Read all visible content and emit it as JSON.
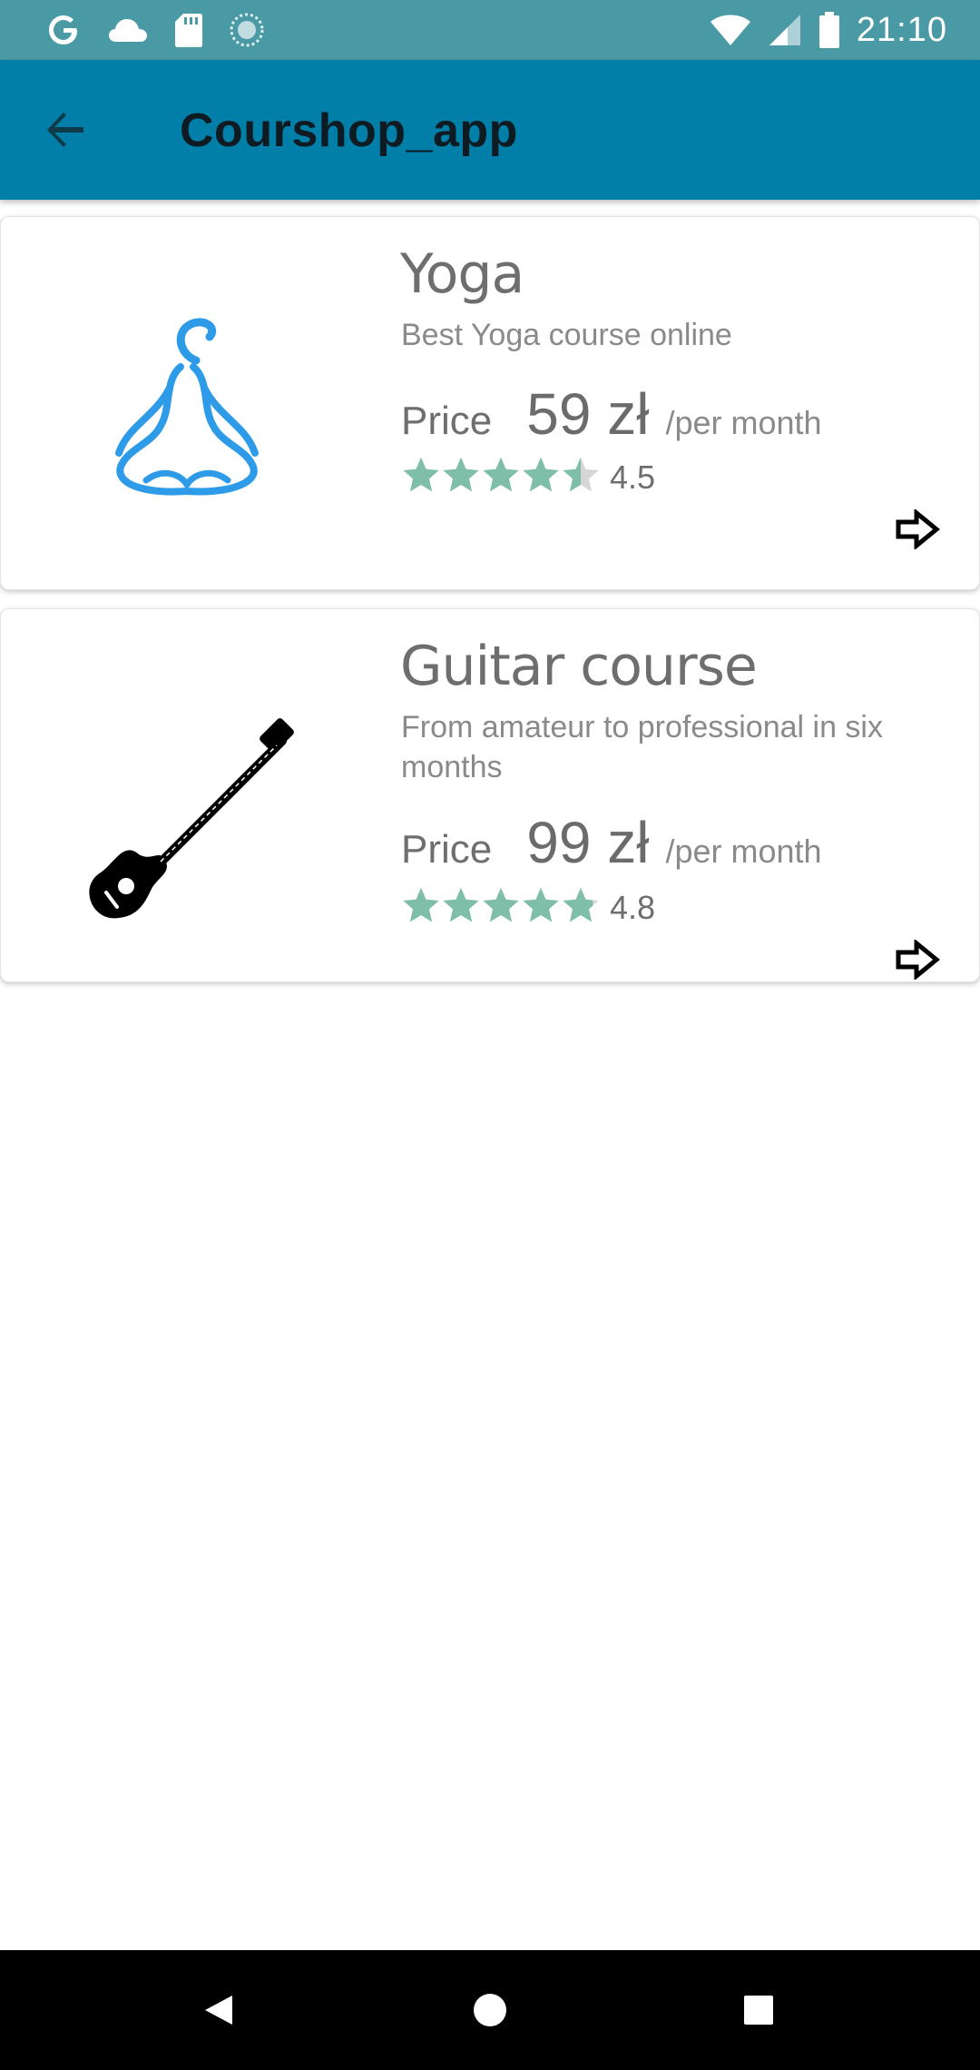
{
  "status_bar": {
    "time": "21:10",
    "left_icons": [
      "google-icon",
      "cloud-icon",
      "sd-card-icon",
      "sync-icon"
    ],
    "right_icons": [
      "wifi-icon",
      "cell-signal-icon",
      "battery-icon"
    ]
  },
  "app_bar": {
    "title": "Courshop_app",
    "background": "#027fa8"
  },
  "courses": [
    {
      "title": "Yoga",
      "description": "Best Yoga course online",
      "price_label": "Price",
      "price": "59 zł",
      "period": "/per month",
      "rating": "4.5",
      "rating_value": 4.5,
      "image": "yoga-meditation-icon"
    },
    {
      "title": "Guitar course",
      "description": "From amateur to professional in six months",
      "price_label": "Price",
      "price": "99 zł",
      "period": "/per month",
      "rating": "4.8",
      "rating_value": 4.8,
      "image": "guitar-icon"
    }
  ],
  "colors": {
    "star_filled": "#7fbfa9",
    "star_empty": "#d6d6d6",
    "status_bar": "#4a9aa6"
  },
  "nav_bar": {
    "buttons": [
      "back-triangle-icon",
      "home-circle-icon",
      "recents-square-icon"
    ]
  }
}
